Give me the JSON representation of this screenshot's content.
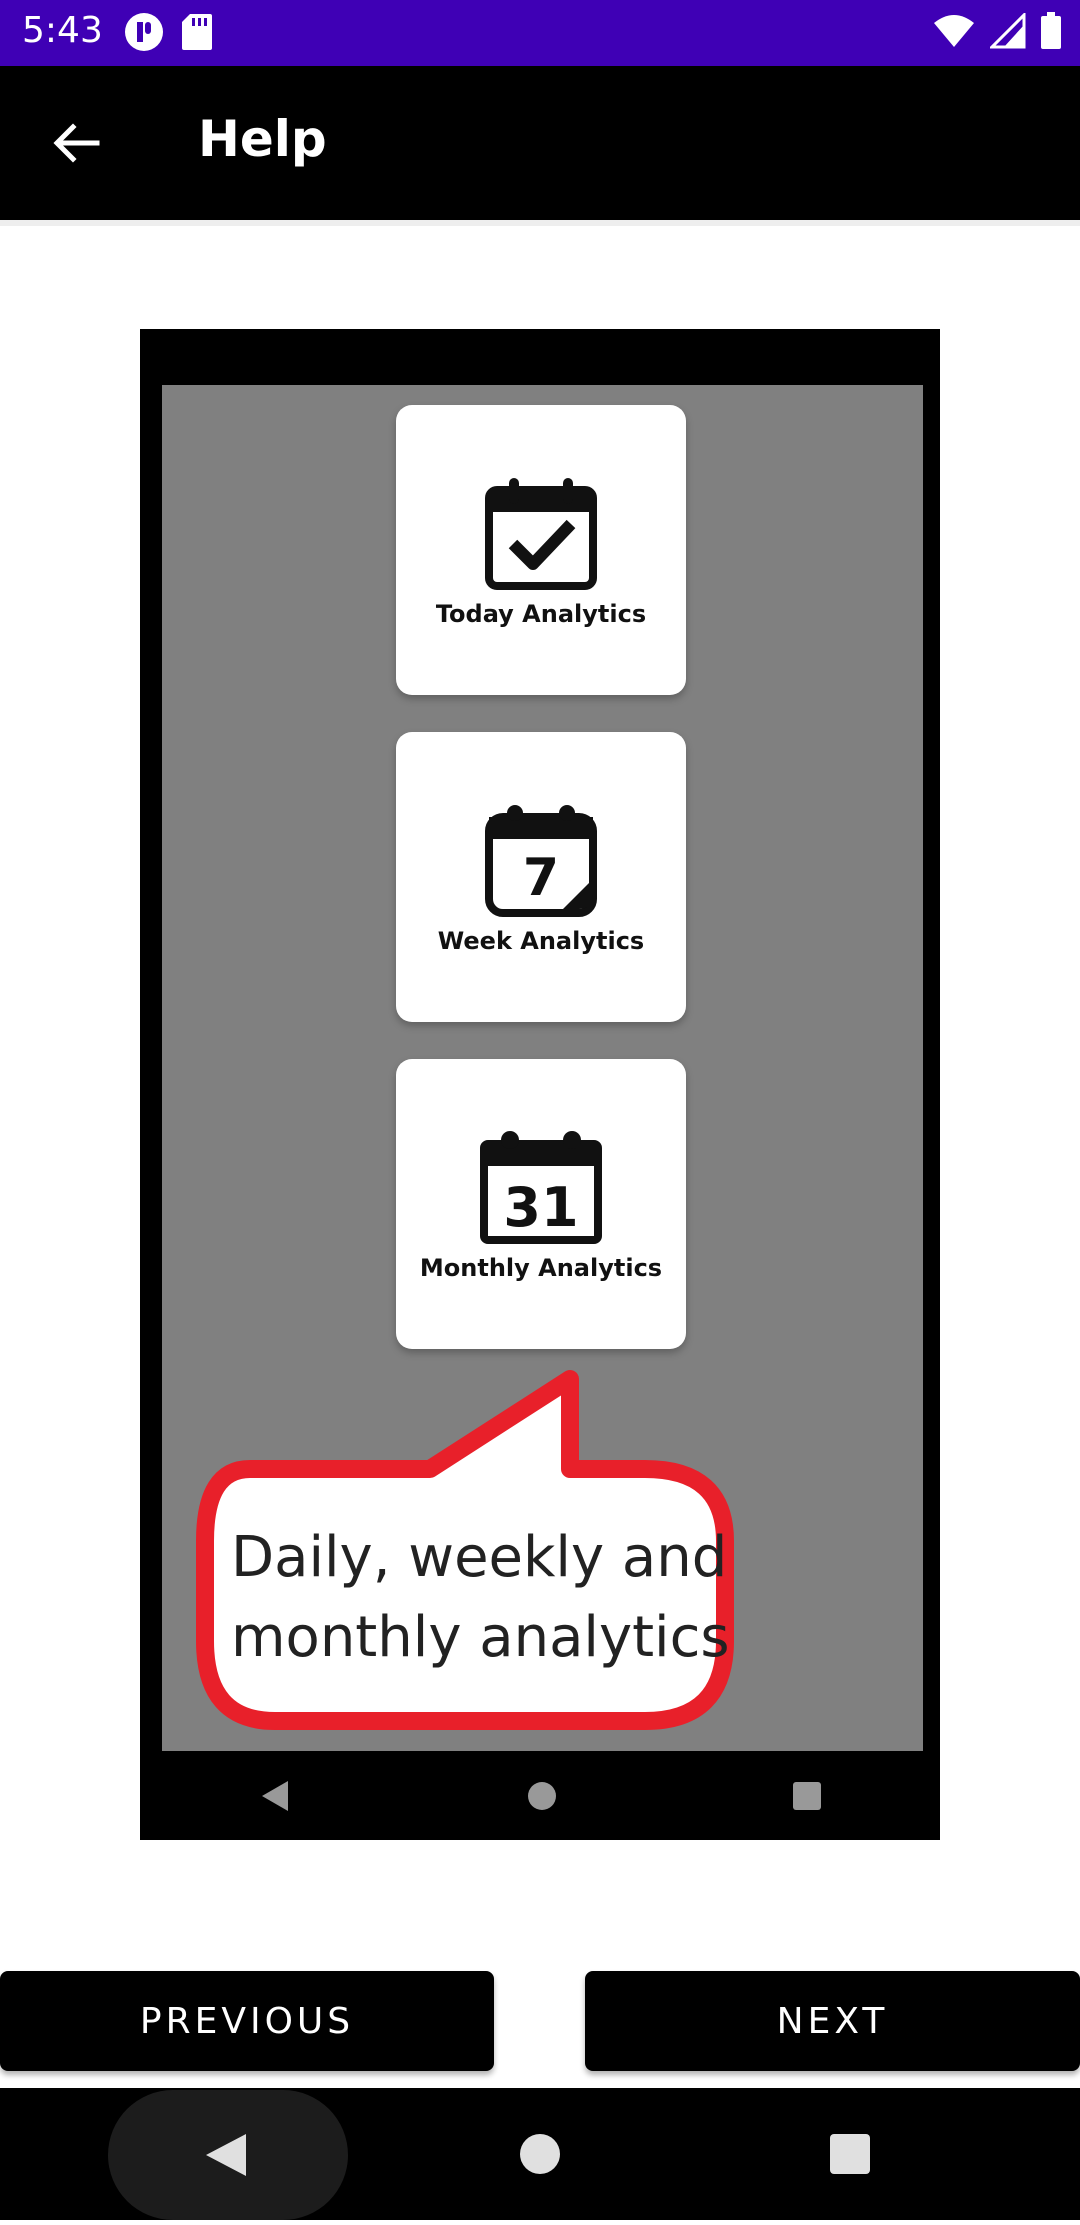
{
  "status_bar": {
    "time": "5:43",
    "bg_color": "#3f00b5"
  },
  "app_bar": {
    "title": "Help",
    "back_icon": "arrow-left-icon"
  },
  "preview": {
    "cards": [
      {
        "label": "Today Analytics",
        "icon": "calendar-check-icon"
      },
      {
        "label": "Week Analytics",
        "icon": "calendar-seven-icon",
        "number": "7"
      },
      {
        "label": "Monthly Analytics",
        "icon": "calendar-31-icon",
        "number": "31"
      }
    ],
    "callout": {
      "line1": "Daily, weekly and",
      "line2": "monthly analytics",
      "border_color": "#e8202a"
    }
  },
  "buttons": {
    "previous": "PREVIOUS",
    "next": "NEXT"
  }
}
